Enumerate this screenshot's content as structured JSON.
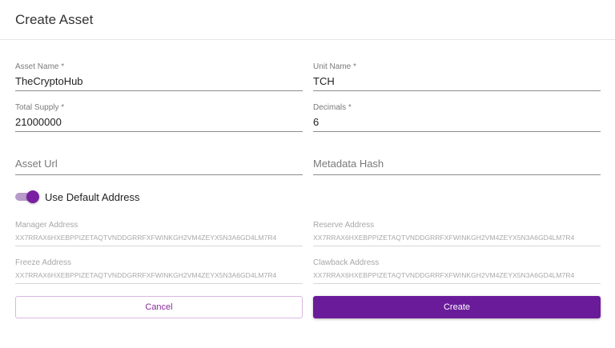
{
  "dialog": {
    "title": "Create Asset"
  },
  "fields": {
    "asset_name": {
      "label": "Asset Name *",
      "value": "TheCryptoHub"
    },
    "unit_name": {
      "label": "Unit Name *",
      "value": "TCH"
    },
    "total_supply": {
      "label": "Total Supply *",
      "value": "21000000"
    },
    "decimals": {
      "label": "Decimals *",
      "value": "6"
    },
    "asset_url": {
      "placeholder": "Asset Url"
    },
    "metadata_hash": {
      "placeholder": "Metadata Hash"
    }
  },
  "default_address_toggle": {
    "label": "Use Default Address",
    "checked": true
  },
  "addresses": {
    "manager": {
      "label": "Manager Address",
      "value": "XX7RRAX6HXEBPPIZETAQTVNDDGRRFXFWINKGH2VM4ZEYX5N3A6GD4LM7R4"
    },
    "reserve": {
      "label": "Reserve Address",
      "value": "XX7RRAX6HXEBPPIZETAQTVNDDGRRFXFWINKGH2VM4ZEYX5N3A6GD4LM7R4"
    },
    "freeze": {
      "label": "Freeze Address",
      "value": "XX7RRAX6HXEBPPIZETAQTVNDDGRRFXFWINKGH2VM4ZEYX5N3A6GD4LM7R4"
    },
    "clawback": {
      "label": "Clawback Address",
      "value": "XX7RRAX6HXEBPPIZETAQTVNDDGRRFXFWINKGH2VM4ZEYX5N3A6GD4LM7R4"
    }
  },
  "buttons": {
    "cancel": "Cancel",
    "create": "Create"
  },
  "colors": {
    "accent": "#6a1b9a",
    "toggle_knob": "#7b1fa2",
    "toggle_track": "#b89bc9",
    "cancel_border": "#d9b8e0"
  }
}
